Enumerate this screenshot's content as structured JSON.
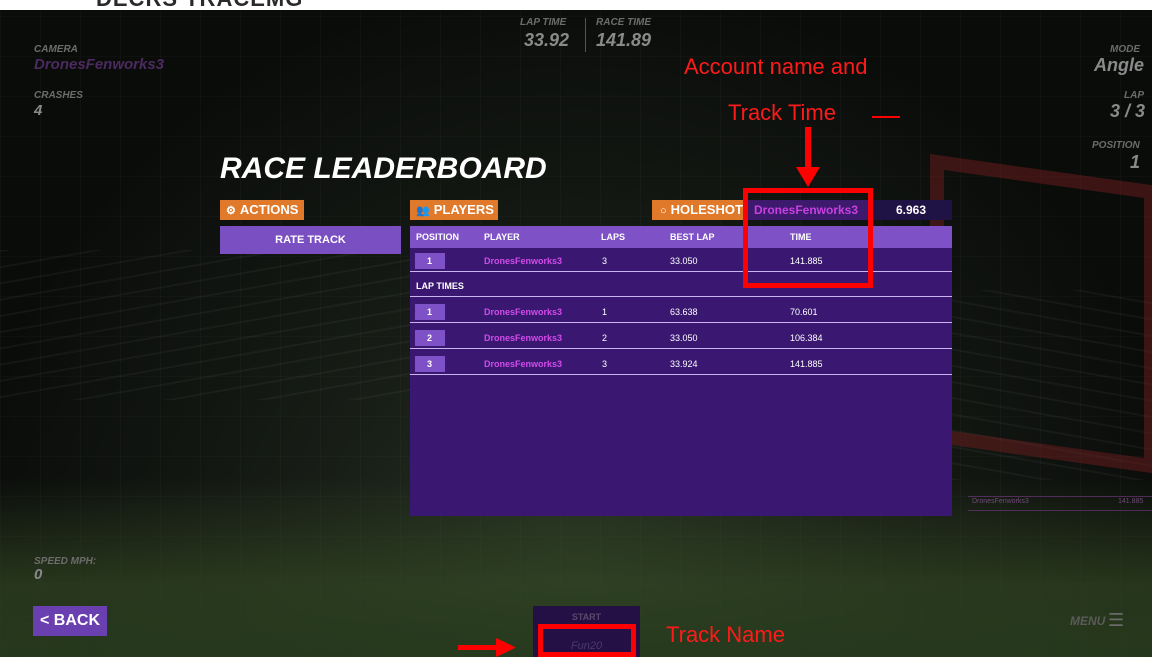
{
  "page_title": "DECRS TRACEMG",
  "hud": {
    "camera_label": "CAMERA",
    "camera_value": "DronesFenworks3",
    "crashes_label": "CRASHES",
    "crashes_value": "4",
    "lap_time_label": "LAP TIME",
    "lap_time_value": "33.92",
    "race_time_label": "RACE TIME",
    "race_time_value": "141.89",
    "mode_label": "MODE",
    "mode_value": "Angle",
    "lap_label": "LAP",
    "lap_value": "3 / 3",
    "position_label": "POSITION",
    "position_value": "1",
    "speed_label": "SPEED MPH:",
    "speed_value": "0"
  },
  "leaderboard": {
    "title": "RACE LEADERBOARD",
    "actions_tab": "ACTIONS",
    "players_tab": "PLAYERS",
    "holeshot_tab": "HOLESHOT",
    "holeshot_player": "DronesFenworks3",
    "holeshot_time": "6.963",
    "rate_track": "RATE TRACK",
    "columns": [
      "POSITION",
      "PLAYER",
      "LAPS",
      "BEST LAP",
      "TIME"
    ],
    "results": [
      {
        "position": "1",
        "player": "DronesFenworks3",
        "laps": "3",
        "best_lap": "33.050",
        "time": "141.885"
      }
    ],
    "lap_times_label": "LAP TIMES",
    "lap_times": [
      {
        "position": "1",
        "player": "DronesFenworks3",
        "lap": "1",
        "best_lap": "63.638",
        "time": "70.601"
      },
      {
        "position": "2",
        "player": "DronesFenworks3",
        "lap": "2",
        "best_lap": "33.050",
        "time": "106.384"
      },
      {
        "position": "3",
        "player": "DronesFenworks3",
        "lap": "3",
        "best_lap": "33.924",
        "time": "141.885"
      }
    ]
  },
  "bottom": {
    "back": "BACK",
    "start": "START",
    "track_name": "Fun20",
    "menu": "MENU"
  },
  "faint_row": {
    "player": "DronesFenworks3",
    "time": "141.885"
  },
  "annotations": {
    "account_line1": "Account name and",
    "account_line2": "Track Time",
    "track_name": "Track Name",
    "color": "#ff0000"
  },
  "colors": {
    "accent_orange": "#e07a2a",
    "panel_purple": "#3a1872",
    "header_purple": "#7e52c6",
    "player_magenta": "#d24bea"
  }
}
